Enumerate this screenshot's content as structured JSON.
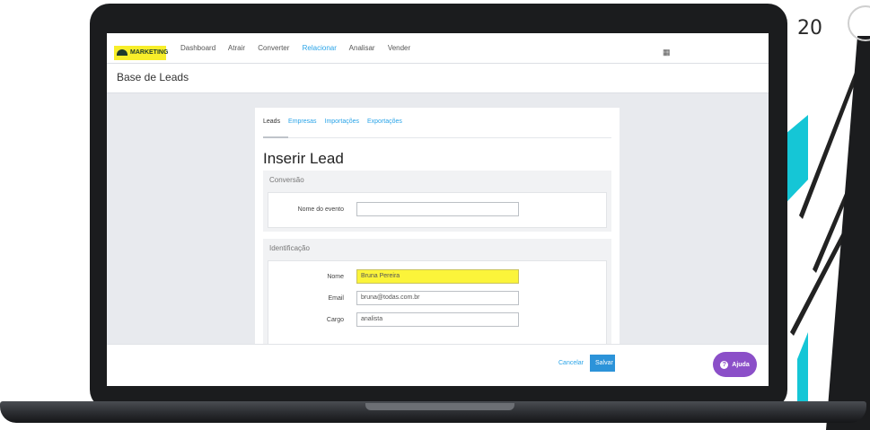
{
  "slide": {
    "number": "20"
  },
  "app": {
    "brand": "MARKETING",
    "nav": [
      "Dashboard",
      "Atrair",
      "Converter",
      "Relacionar",
      "Analisar",
      "Vender"
    ],
    "active_nav": "Relacionar",
    "page_title": "Base de Leads"
  },
  "card": {
    "tabs": [
      "Leads",
      "Empresas",
      "Importações",
      "Exportações"
    ],
    "active_tab": "Leads",
    "title": "Inserir Lead",
    "conversion": {
      "title": "Conversão",
      "event_label": "Nome do evento",
      "event_value": ""
    },
    "identification": {
      "title": "Identificação",
      "name_label": "Nome",
      "name_value": "Bruna Pereira",
      "email_label": "Email",
      "email_value": "bruna@todas.com.br",
      "role_label": "Cargo",
      "role_value": "analista"
    }
  },
  "footer": {
    "cancel_label": "Cancelar",
    "save_label": "Salvar",
    "help_label": "Ajuda"
  },
  "colors": {
    "accent": "#2aa4e8",
    "highlight": "#fbf43a",
    "help": "#8b4fc8",
    "save": "#2c93d9"
  },
  "icons": [
    "grid-icon",
    "help-icon",
    "brand-logo-icon"
  ]
}
